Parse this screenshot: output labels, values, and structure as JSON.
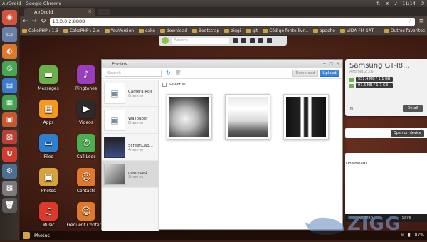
{
  "os_bar": {
    "title": "AirDroid - Google Chrome",
    "time": "11:14"
  },
  "browser": {
    "tab_title": "AirDroid",
    "url": "10.0.0.2:8888",
    "bookmarks": [
      "CakePHP : 1.3",
      "CakePHP : 2.x",
      "YouVersion",
      "cake",
      "download",
      "Bootstrap",
      "ziggi",
      "git",
      "Código fonte livr...",
      "apache",
      "VIDA FM SAT"
    ],
    "other_bookmarks": "Outros favoritos"
  },
  "dock": {
    "search_placeholder": "Search"
  },
  "apps": [
    {
      "label": "Messages",
      "color": "#6ab04c",
      "icon": "message-icon"
    },
    {
      "label": "Ringtones",
      "color": "#9b3dbf",
      "icon": "music-note-icon"
    },
    {
      "label": "Apps",
      "color": "#f39a1e",
      "icon": "apps-icon"
    },
    {
      "label": "Videos",
      "color": "#2b2b2b",
      "icon": "clapper-icon"
    },
    {
      "label": "Files",
      "color": "#2f7fd1",
      "icon": "folder-icon"
    },
    {
      "label": "Call Logs",
      "color": "#4caf50",
      "icon": "phone-icon"
    },
    {
      "label": "Photos",
      "color": "#d9a33b",
      "icon": "photo-icon"
    },
    {
      "label": "Contacts",
      "color": "#e07a2a",
      "icon": "contact-icon"
    },
    {
      "label": "Music",
      "color": "#d93a2b",
      "icon": "music-icon"
    },
    {
      "label": "Frequent Contacts",
      "color": "#e07a2a",
      "icon": "contact-icon"
    }
  ],
  "photos_window": {
    "title": "Photos",
    "search_placeholder": "Search",
    "download_label": "Download",
    "upload_label": "Upload",
    "select_all_label": "Select all",
    "albums": [
      {
        "name": "Camera Roll",
        "count": "0item(s)"
      },
      {
        "name": "Wallpaper",
        "count": "0item(s)"
      },
      {
        "name": "ScreenCap...",
        "count": "4item(s)"
      },
      {
        "name": "download",
        "count": "3item(s)"
      }
    ]
  },
  "device": {
    "name": "Samsung GT-I8...",
    "os": "Android 2.3.6",
    "storage1": "551.4 MB / 1.1 GB",
    "storage2": "97.6 MB / 1.7 GB",
    "detail_label": "Detail"
  },
  "open_device_label": "Open on device",
  "notes_text": "Downloads",
  "notes_actions": {
    "refresh": "Refresh",
    "save": "Save"
  },
  "taskbar": {
    "label": "Photos",
    "battery": "87%"
  },
  "watermark": "ZIGG"
}
